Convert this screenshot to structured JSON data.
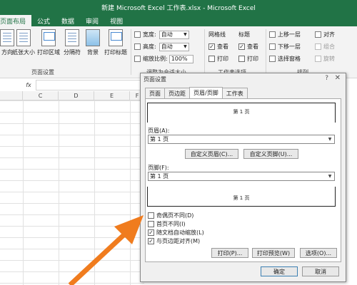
{
  "window": {
    "title": "新建 Microsoft Excel 工作表.xlsx - Microsoft Excel"
  },
  "ribbon_tabs": [
    "页面布局",
    "公式",
    "数据",
    "审阅",
    "视图"
  ],
  "ribbon": {
    "page_setup": {
      "buttons": [
        "方向",
        "纸张大小",
        "打印区域",
        "分隔符",
        "背景",
        "打印标题"
      ],
      "label": "页面设置"
    },
    "scale_to_fit": {
      "width_label": "宽度:",
      "width_value": "自动",
      "height_label": "高度:",
      "height_value": "自动",
      "scale_label": "缩放比例:",
      "scale_value": "100%",
      "label": "调整为合适大小"
    },
    "sheet_options": {
      "gridlines_label": "网格线",
      "headings_label": "标题",
      "view_label": "查看",
      "print_label": "打印",
      "gridlines_view": true,
      "gridlines_print": false,
      "headings_view": true,
      "headings_print": false,
      "label": "工作表选项"
    },
    "arrange": {
      "items": [
        "上移一层",
        "下移一层",
        "选择窗格"
      ],
      "align_label": "对齐",
      "group_label": "组合",
      "rotate_label": "旋转",
      "label": "排列"
    }
  },
  "formula_bar": {
    "fx": "fx"
  },
  "columns": [
    "C",
    "D",
    "E",
    "F"
  ],
  "dialog": {
    "title": "页面设置",
    "help": "?",
    "close": "✕",
    "tabs": [
      "页面",
      "页边距",
      "页眉/页脚",
      "工作表"
    ],
    "active_tab": "页眉/页脚",
    "header_preview": "第 1 页",
    "header_label": "页眉(A):",
    "header_value": "第 1 页",
    "custom_header": "自定义页眉(C)...",
    "custom_footer": "自定义页脚(U)...",
    "footer_label": "页脚(F):",
    "footer_value": "第 1 页",
    "footer_preview": "第 1 页",
    "options": [
      {
        "label": "奇偶页不同(D)",
        "checked": false
      },
      {
        "label": "首页不同(I)",
        "checked": false
      },
      {
        "label": "随文档自动缩放(L)",
        "checked": true
      },
      {
        "label": "与页边距对齐(M)",
        "checked": true
      }
    ],
    "print_button": "打印(P)...",
    "preview_button": "打印预览(W)",
    "options_button": "选项(O)...",
    "ok_button": "确定",
    "cancel_button": "取消"
  },
  "colors": {
    "excel_green": "#217346",
    "arrow": "#f07c1e"
  }
}
